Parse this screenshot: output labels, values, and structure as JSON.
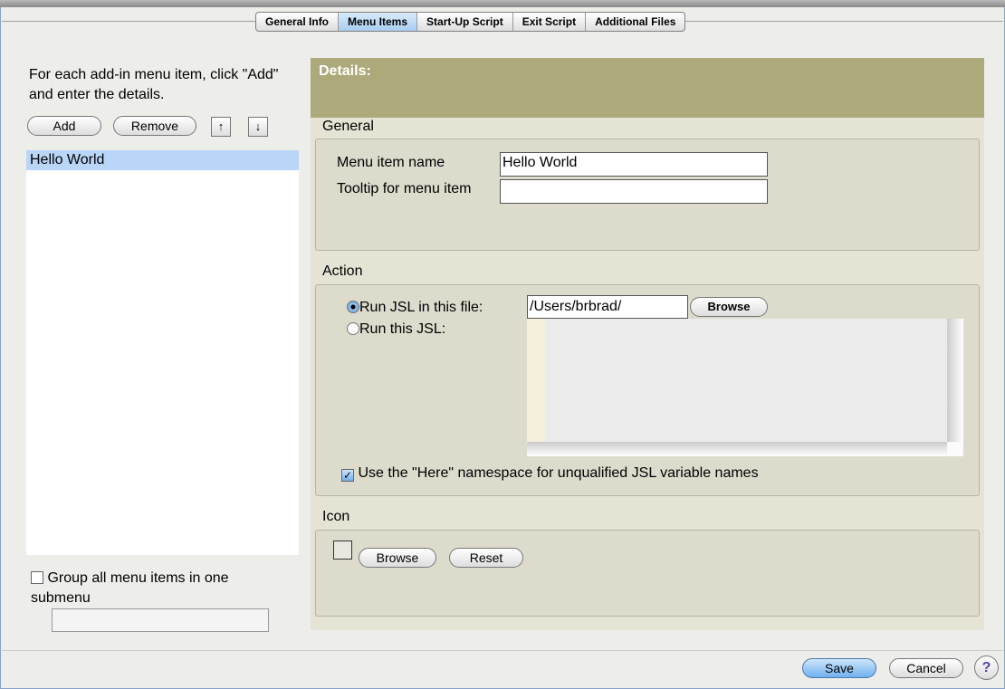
{
  "tabs": [
    "General Info",
    "Menu Items",
    "Start-Up Script",
    "Exit Script",
    "Additional Files"
  ],
  "active_tab": "Menu Items",
  "left": {
    "instructions": "For each add-in menu item, click \"Add\" and enter the details.",
    "add_label": "Add",
    "remove_label": "Remove",
    "up_icon": "↑",
    "down_icon": "↓",
    "items": [
      "Hello World"
    ],
    "group_label": "Group all menu items in one submenu",
    "group_checked": false,
    "submenu_value": ""
  },
  "details": {
    "title": "Details:",
    "general": {
      "heading": "General",
      "name_label": "Menu item name",
      "name_value": "Hello World",
      "tooltip_label": "Tooltip for menu item",
      "tooltip_value": ""
    },
    "action": {
      "heading": "Action",
      "run_file_label": "Run JSL in this file:",
      "run_file_value": "/Users/brbrad/",
      "browse_label": "Browse",
      "run_jsl_label": "Run this JSL:",
      "selected": "file",
      "jsl_text": "",
      "here_label": "Use the \"Here\" namespace for unqualified JSL variable names",
      "here_checked": true
    },
    "icon": {
      "heading": "Icon",
      "browse_label": "Browse",
      "reset_label": "Reset"
    }
  },
  "footer": {
    "save_label": "Save",
    "cancel_label": "Cancel",
    "help_label": "?"
  }
}
